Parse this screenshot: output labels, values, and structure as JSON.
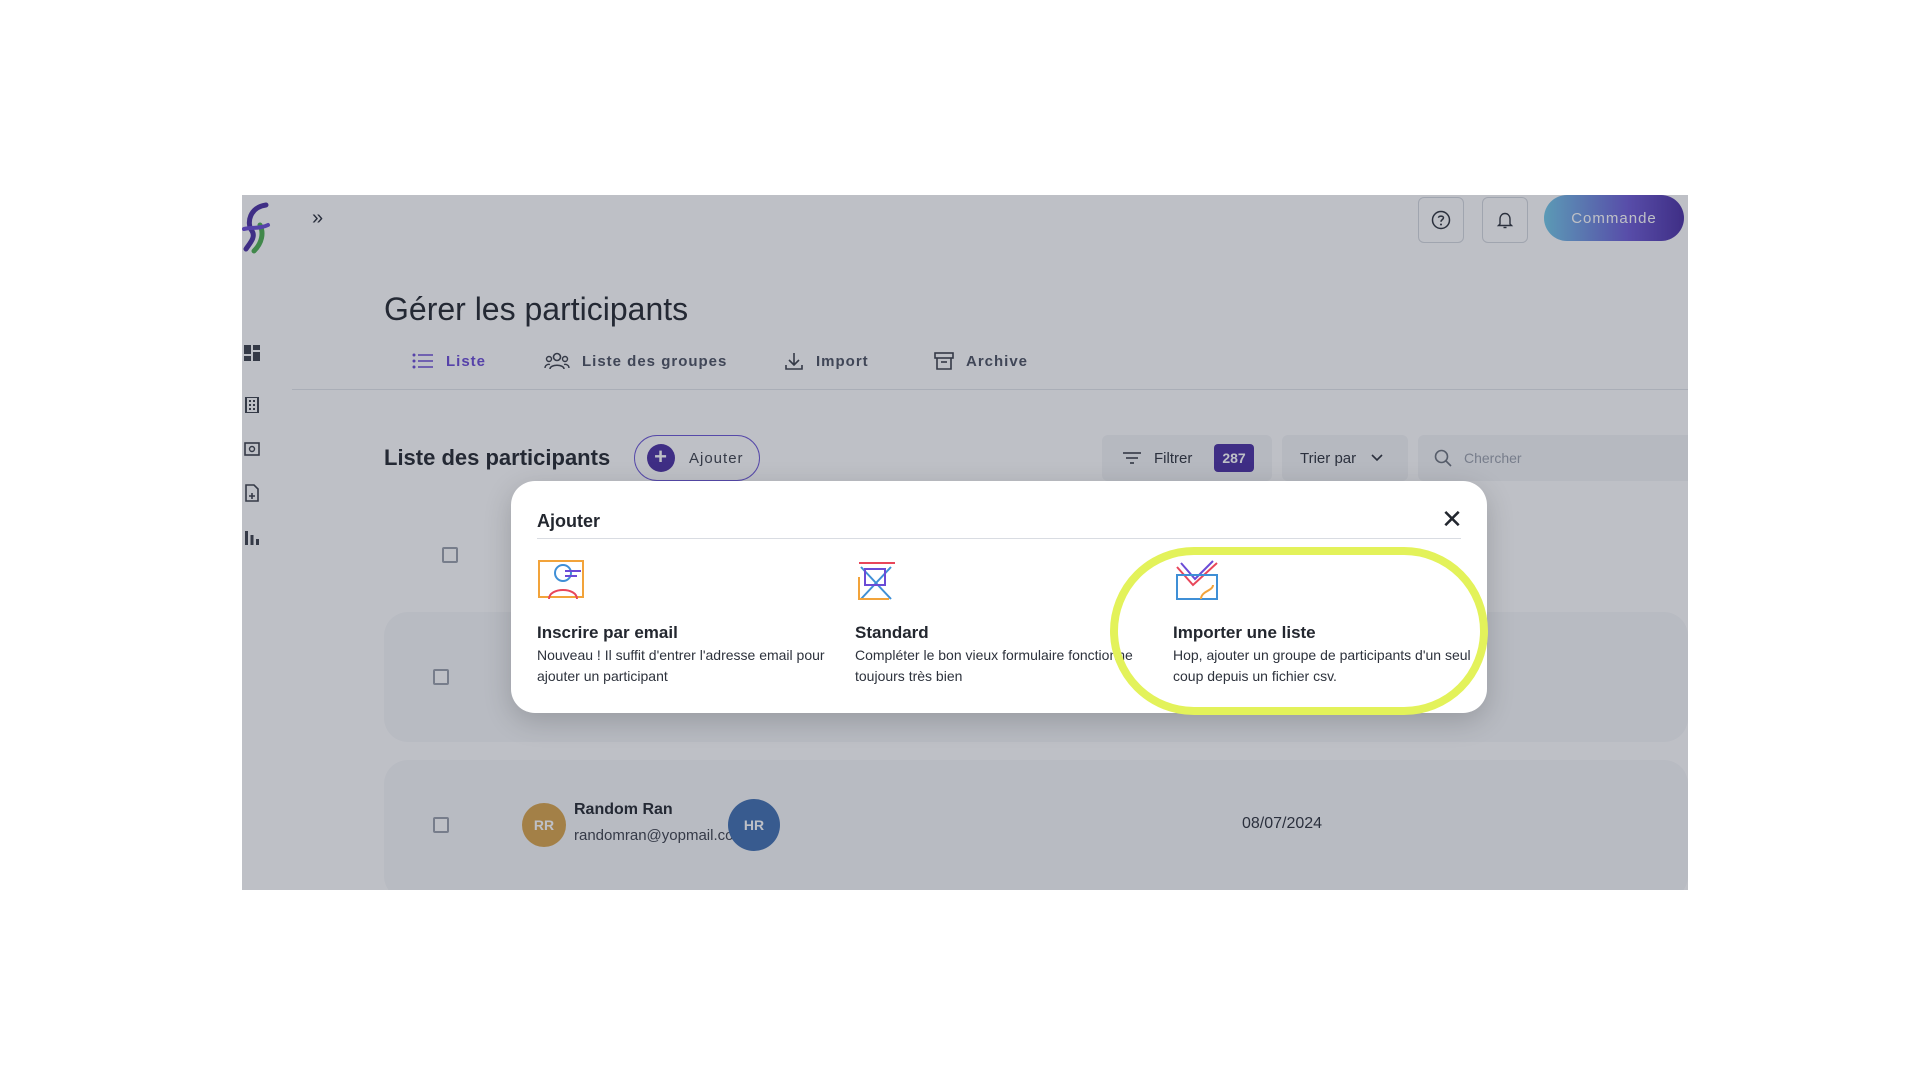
{
  "header": {
    "expand_glyph": "»",
    "command_label": "Commande"
  },
  "page": {
    "title": "Gérer les participants",
    "tabs": [
      {
        "label": "Liste",
        "active": true
      },
      {
        "label": "Liste des groupes",
        "active": false
      },
      {
        "label": "Import",
        "active": false
      },
      {
        "label": "Archive",
        "active": false
      }
    ]
  },
  "toolbar": {
    "section_title": "Liste des participants",
    "add_label": "Ajouter",
    "filter_label": "Filtrer",
    "filter_count": "287",
    "sort_label": "Trier par",
    "search_placeholder": "Chercher"
  },
  "rows": [
    {
      "initials": "RR",
      "name": "Random Ran",
      "email": "randomran@yopmail.co",
      "second_initials": "HR",
      "date": "08/07/2024"
    }
  ],
  "modal": {
    "title": "Ajouter",
    "close_glyph": "✕",
    "options": [
      {
        "title": "Inscrire par email",
        "desc": "Nouveau ! Il suffit d'entrer l'adresse email pour ajouter un participant"
      },
      {
        "title": "Standard",
        "desc": "Compléter le bon vieux formulaire fonctionne toujours très bien"
      },
      {
        "title": "Importer une liste",
        "desc": "Hop, ajouter un groupe de participants d'un seul coup depuis un fichier csv."
      }
    ]
  },
  "colors": {
    "brand_purple": "#4a2fa3",
    "accent_purple": "#6b4bd6",
    "highlight": "#e3f25a",
    "avatar_rr": "#d9a44a",
    "avatar_hr": "#3f6fb0"
  }
}
